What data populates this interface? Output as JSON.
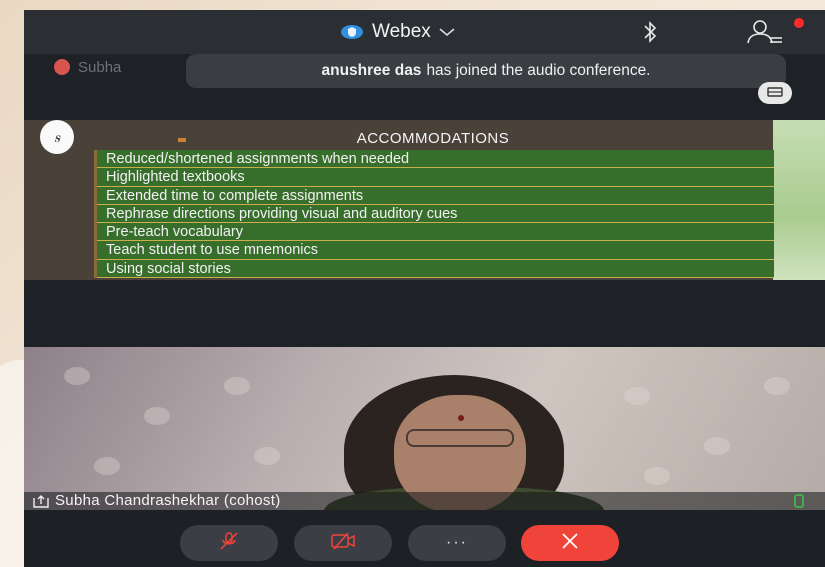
{
  "topbar": {
    "app_name": "Webex",
    "icons": [
      "shield-icon",
      "chevron-down-icon",
      "bluetooth-icon",
      "participants-icon"
    ]
  },
  "speaker": {
    "name": "Subha"
  },
  "notification": {
    "name": "anushree das",
    "message": "has joined the audio conference."
  },
  "slide": {
    "title": "ACCOMMODATIONS",
    "items": [
      "Reduced/shortened assignments when needed",
      "Highlighted textbooks",
      "Extended time to complete assignments",
      "Rephrase directions providing visual and auditory cues",
      "Pre-teach vocabulary",
      "Teach student to use mnemonics",
      "Using social stories"
    ]
  },
  "video": {
    "participant_label": "Subha Chandrashekhar (cohost)"
  },
  "controls": {
    "more_label": "···"
  },
  "colors": {
    "end_call": "#f0433a",
    "notification_dot": "#ff2b2b",
    "slide_green": "#386e2c",
    "signal_green": "#3cc24a"
  }
}
